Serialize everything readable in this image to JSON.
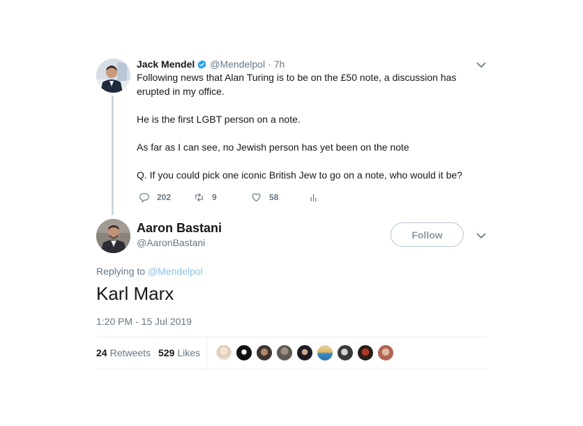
{
  "parent_tweet": {
    "author_name": "Jack Mendel",
    "handle": "@Mendelpol",
    "separator": "·",
    "time_ago": "7h",
    "paragraphs": [
      "Following news that Alan Turing is to be on the £50 note, a discussion has erupted in my office.",
      "He is the first LGBT person on a note.",
      "As far as I can see, no Jewish person has yet been on the note",
      "Q. If you could pick one iconic British Jew to go on a note, who would it be?"
    ],
    "actions": {
      "replies": "202",
      "retweets": "9",
      "likes": "58"
    }
  },
  "main_tweet": {
    "author_name": "Aaron Bastani",
    "handle": "@AaronBastani",
    "follow_label": "Follow",
    "replying_prefix": "Replying to",
    "replying_to": "@Mendelpol",
    "text": "Karl Marx",
    "timestamp": "1:20 PM - 15 Jul 2019",
    "stats": {
      "retweets_count": "24",
      "retweets_label": "Retweets",
      "likes_count": "529",
      "likes_label": "Likes"
    }
  },
  "colors": {
    "text": "#14171a",
    "secondary": "#657786",
    "verified": "#1da1f2",
    "mention": "#8ec0e8",
    "border": "#e6ecf0"
  },
  "icons": {
    "verified": "verified-badge-icon",
    "caret": "chevron-down-icon",
    "reply": "reply-icon",
    "retweet": "retweet-icon",
    "like": "heart-icon",
    "stats": "analytics-icon"
  }
}
